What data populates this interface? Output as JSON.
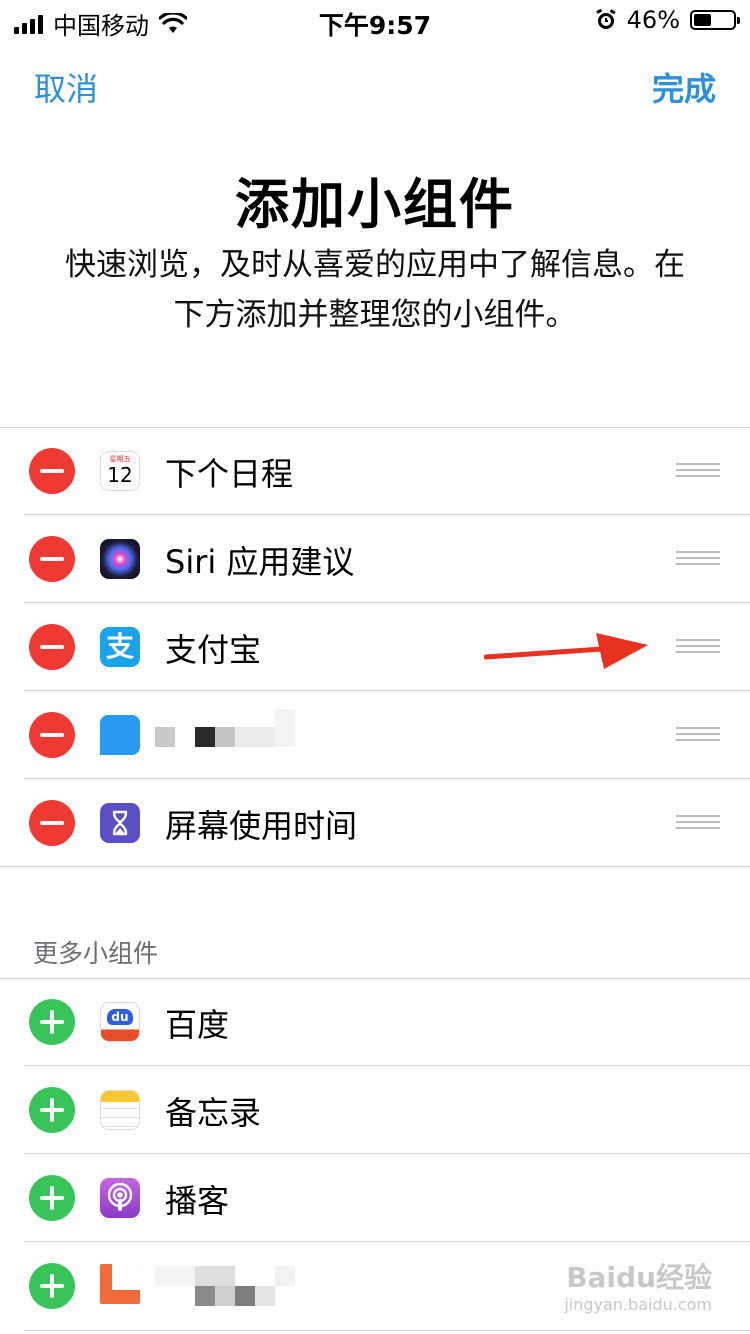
{
  "status_bar": {
    "carrier": "中国移动",
    "time": "下午9:57",
    "battery_percent_label": "46%",
    "battery_level": 0.46
  },
  "nav": {
    "cancel_label": "取消",
    "done_label": "完成"
  },
  "header": {
    "title": "添加小组件",
    "subtitle": "快速浏览，及时从喜爱的应用中了解信息。在下方添加并整理您的小组件。"
  },
  "active_widgets": [
    {
      "label": "下个日程",
      "icon": "calendar-icon",
      "calendar_day": "12",
      "calendar_weekday": "星期五"
    },
    {
      "label": "Siri 应用建议",
      "icon": "siri-icon"
    },
    {
      "label": "支付宝",
      "icon": "alipay-icon",
      "icon_text": "支"
    },
    {
      "label": "",
      "icon": "blurred-app-icon"
    },
    {
      "label": "屏幕使用时间",
      "icon": "hourglass-icon"
    }
  ],
  "more_section": {
    "header": "更多小组件",
    "items": [
      {
        "label": "百度",
        "icon": "baidu-icon",
        "icon_text": "du"
      },
      {
        "label": "备忘录",
        "icon": "notes-icon"
      },
      {
        "label": "播客",
        "icon": "podcasts-icon"
      },
      {
        "label": "",
        "icon": "blurred-app-icon"
      }
    ]
  },
  "watermark": {
    "brand": "Baidu经验",
    "url": "jingyan.baidu.com"
  },
  "colors": {
    "accent": "#2f8fd8",
    "remove": "#ee3a32",
    "add": "#39c45a",
    "annotation_arrow": "#e8321f"
  }
}
